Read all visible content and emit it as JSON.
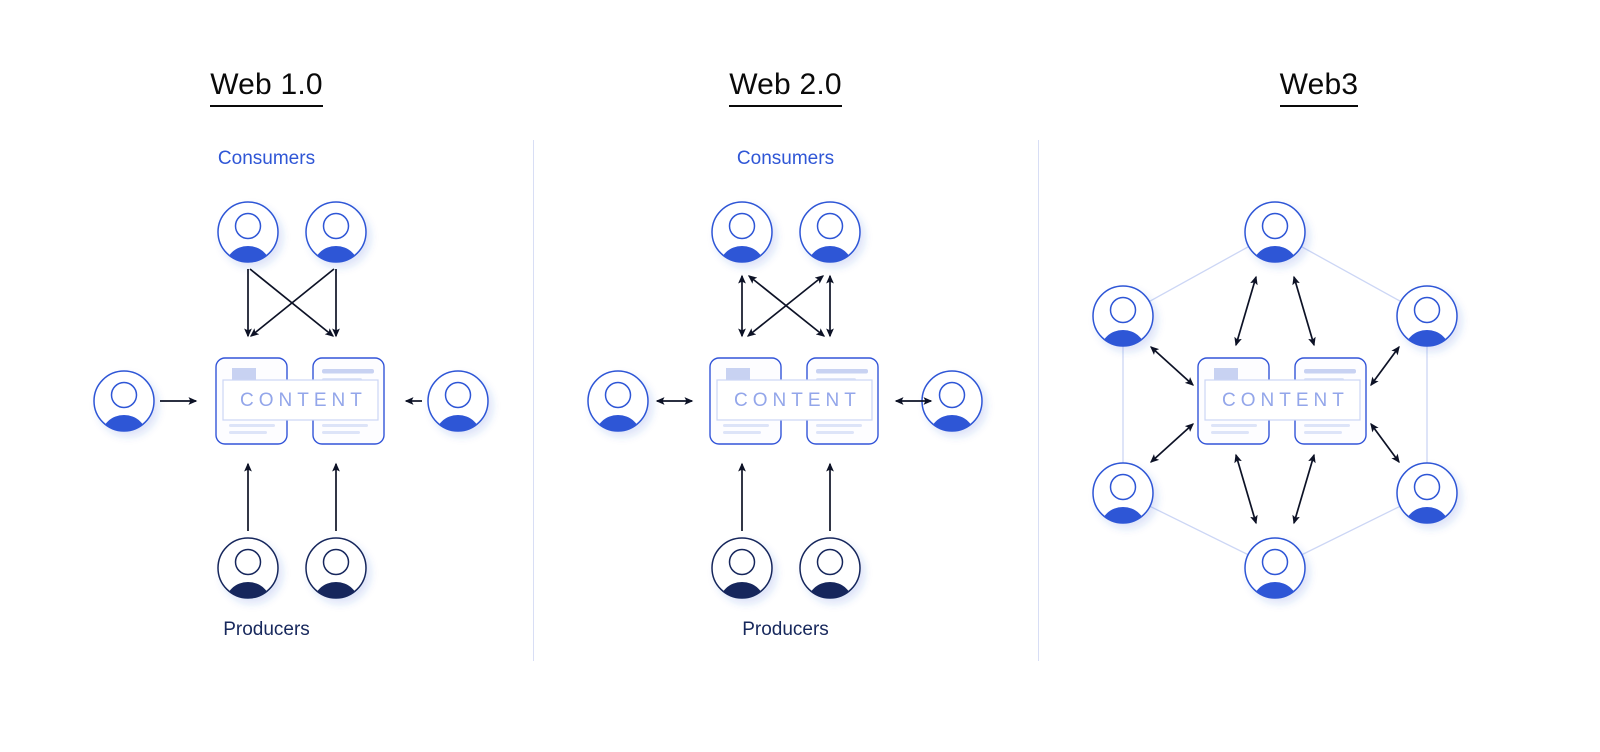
{
  "diagram": {
    "title_web1": "Web 1.0",
    "title_web2": "Web 2.0",
    "title_web3": "Web3",
    "label_consumers": "Consumers",
    "label_producers": "Producers",
    "content_label": "CONTENT"
  },
  "colors": {
    "consumer_blue": "#2f56d6",
    "producer_navy": "#17285c",
    "content_text": "#93a6ea",
    "card_outline": "#3355d8",
    "faint_line": "#ccd6f5",
    "divider": "#d8def5",
    "arrow_black": "#0d1226",
    "title_black": "#0a0a0a",
    "background": "#ffffff"
  },
  "panels": [
    {
      "id": "web1",
      "title": "Web 1.0",
      "has_consumers_label": true,
      "has_producers_label": true,
      "top_consumers": 2,
      "side_consumers": 2,
      "bottom_producers": 2,
      "arrow_style_top": "one-way-down",
      "arrow_style_sides": "one-way-inward",
      "arrow_style_bottom": "one-way-up",
      "content_label": "CONTENT"
    },
    {
      "id": "web2",
      "title": "Web 2.0",
      "has_consumers_label": true,
      "has_producers_label": true,
      "top_consumers": 2,
      "side_consumers": 2,
      "bottom_producers": 2,
      "arrow_style_top": "two-way",
      "arrow_style_sides": "two-way",
      "arrow_style_bottom": "one-way-up",
      "content_label": "CONTENT"
    },
    {
      "id": "web3",
      "title": "Web3",
      "has_consumers_label": false,
      "has_producers_label": false,
      "network_nodes": 6,
      "network_shape": "hexagon",
      "arrow_style": "two-way-all",
      "content_label": "CONTENT"
    }
  ]
}
